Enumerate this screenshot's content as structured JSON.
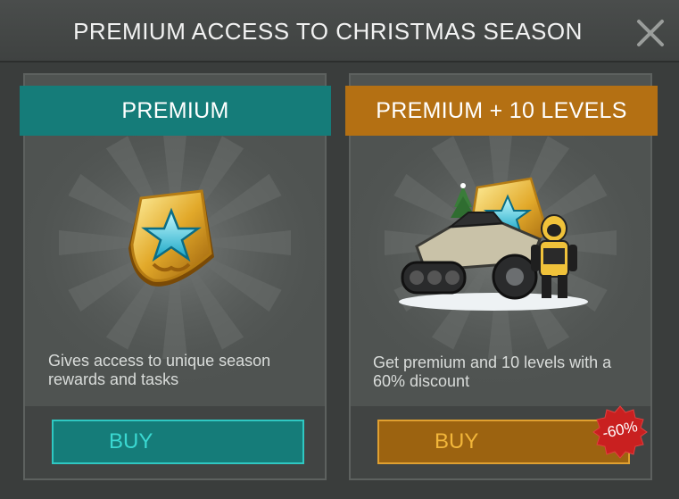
{
  "dialog": {
    "title": "PREMIUM ACCESS TO CHRISTMAS SEASON",
    "close_icon": "close-x-icon"
  },
  "offers": [
    {
      "title": "PREMIUM",
      "description_lines": [
        "Gives access to unique season",
        "rewards and tasks"
      ],
      "button_label": "BUY",
      "accent_color": "#157c79",
      "image_icon": "premium-badge-icon"
    },
    {
      "title": "PREMIUM + 10 LEVELS",
      "description_lines": [
        "Get premium and 10 levels with a",
        "60% discount"
      ],
      "button_label": "BUY",
      "accent_color": "#b47013",
      "image_icon": "premium-vehicle-bundle-icon",
      "discount_badge": "-60%"
    }
  ]
}
